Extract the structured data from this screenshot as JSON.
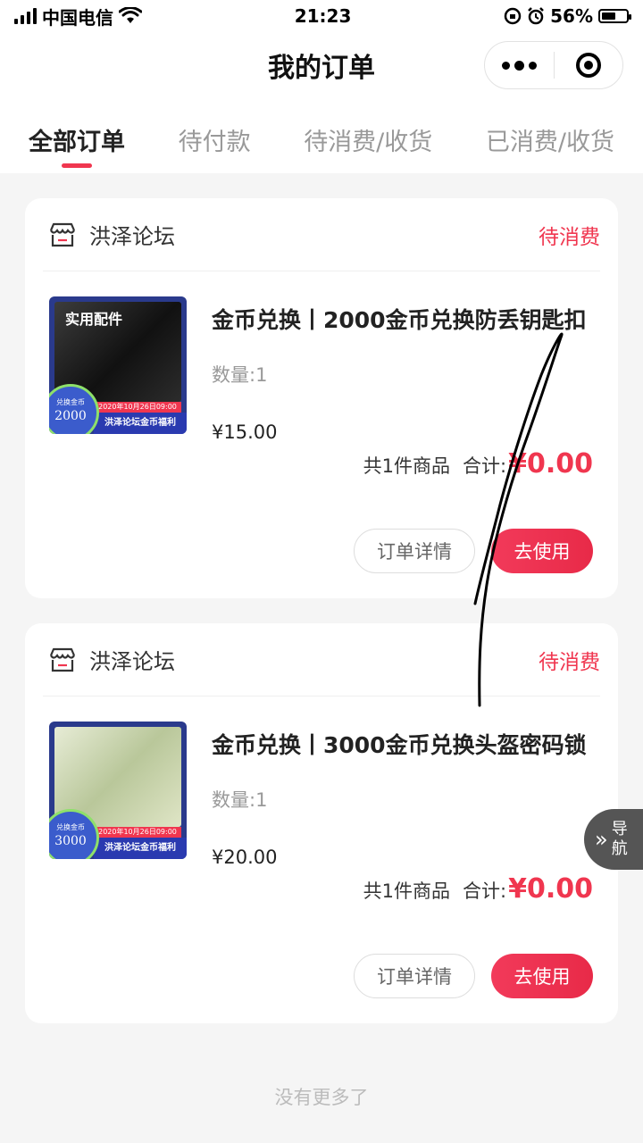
{
  "status_bar": {
    "carrier": "中国电信",
    "time": "21:23",
    "battery": "56%",
    "battery_level": 0.56,
    "icons": [
      "signal-icon",
      "wifi-icon",
      "orientation-lock-icon",
      "alarm-icon",
      "battery-icon"
    ]
  },
  "nav": {
    "title": "我的订单",
    "icons": [
      "more-icon",
      "close-target-icon"
    ]
  },
  "tabs": [
    {
      "label": "全部订单",
      "active": true
    },
    {
      "label": "待付款",
      "active": false
    },
    {
      "label": "待消费/收货",
      "active": false
    },
    {
      "label": "已消费/收货",
      "active": false
    }
  ],
  "orders": [
    {
      "shop": "洪泽论坛",
      "status": "待消费",
      "title": "金币兑换丨2000金币兑换防丢钥匙扣",
      "qty": "数量:1",
      "price": "¥15.00",
      "count": "共1件商品",
      "total_label": "合计:",
      "total": "¥0.00",
      "detail_btn": "订单详情",
      "use_btn": "去使用",
      "thumb": {
        "heading": "实用配件",
        "badge_label": "兑换金币",
        "badge_value": "2000",
        "date": "2020年10月26日09:00",
        "banner": "洪泽论坛金币福利"
      }
    },
    {
      "shop": "洪泽论坛",
      "status": "待消费",
      "title": "金币兑换丨3000金币兑换头盔密码锁",
      "qty": "数量:1",
      "price": "¥20.00",
      "count": "共1件商品",
      "total_label": "合计:",
      "total": "¥0.00",
      "detail_btn": "订单详情",
      "use_btn": "去使用",
      "thumb": {
        "heading": "",
        "badge_label": "兑换金币",
        "badge_value": "3000",
        "date": "2020年10月26日09:00",
        "banner": "洪泽论坛金币福利"
      }
    }
  ],
  "footer": "没有更多了",
  "float_nav": {
    "arrow": "»",
    "label": "导航"
  },
  "colors": {
    "accent": "#f0364f",
    "background": "#f5f5f5"
  }
}
